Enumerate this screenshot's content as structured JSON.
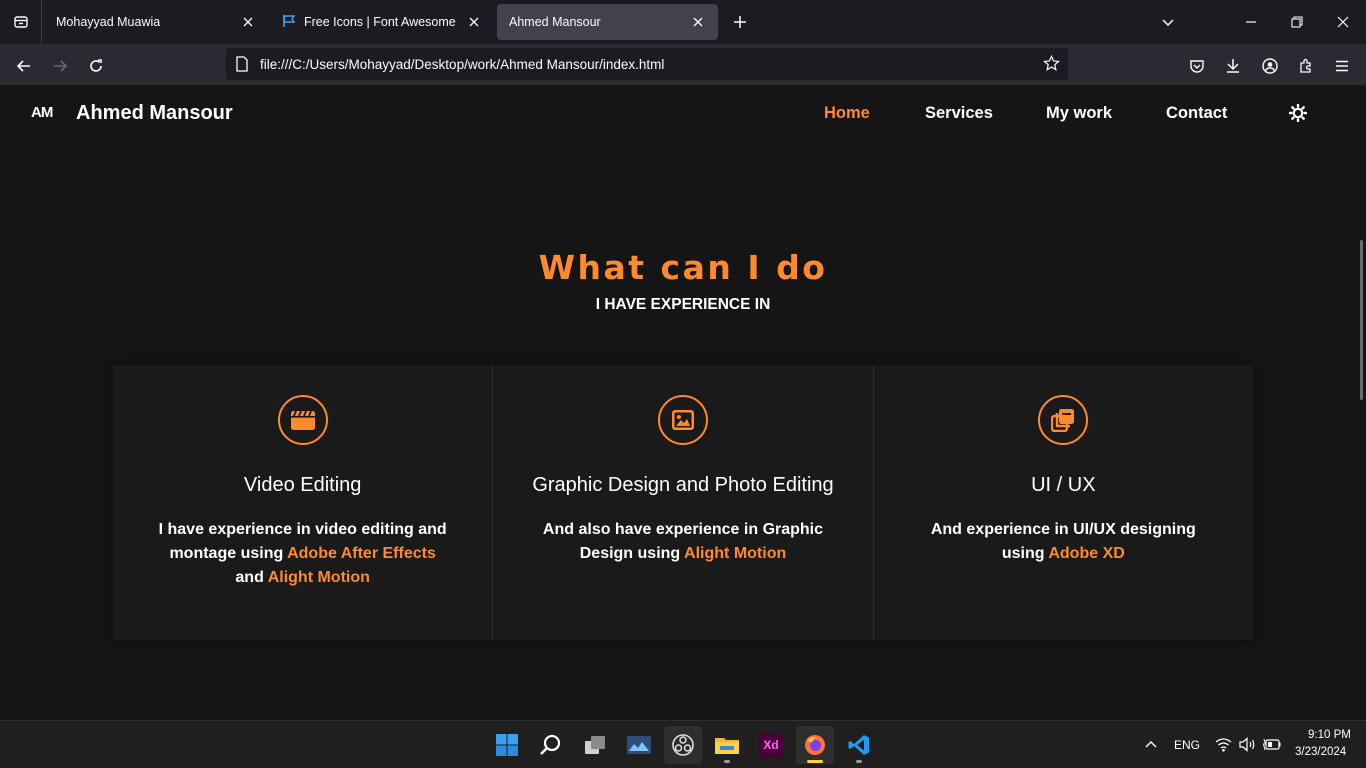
{
  "browser": {
    "tabs": [
      {
        "title": "Mohayyad Muawia",
        "active": false
      },
      {
        "title": "Free Icons | Font Awesome",
        "active": false
      },
      {
        "title": "Ahmed Mansour",
        "active": true
      }
    ],
    "url": "file:///C:/Users/Mohayyad/Desktop/work/Ahmed Mansour/index.html"
  },
  "site": {
    "logo": "AM",
    "brand": "Ahmed Mansour",
    "menu": [
      "Home",
      "Services",
      "My work",
      "Contact"
    ],
    "active_menu": "Home"
  },
  "section": {
    "title": "What can I do",
    "subtitle": "I HAVE EXPERIENCE IN"
  },
  "cards": [
    {
      "icon": "clapperboard-icon",
      "title": "Video Editing",
      "text_1": "I have experience in video editing and montage using ",
      "hl_1": "Adobe After Effects",
      "text_2": " and ",
      "hl_2": "Alight Motion"
    },
    {
      "icon": "image-icon",
      "title": "Graphic Design and Photo Editing",
      "text_1": "And also have experience in Graphic Design using ",
      "hl_1": "Alight Motion"
    },
    {
      "icon": "clone-icon",
      "title": "UI / UX",
      "text_1": "And experience in UI/UX designing using ",
      "hl_1": "Adobe XD"
    }
  ],
  "taskbar": {
    "language": "ENG",
    "time": "9:10 PM",
    "date": "3/23/2024",
    "xd_label": "Xd"
  },
  "colors": {
    "accent": "#ff8a2b",
    "page_bg": "#151515",
    "card_bg": "#1a1a1a"
  }
}
